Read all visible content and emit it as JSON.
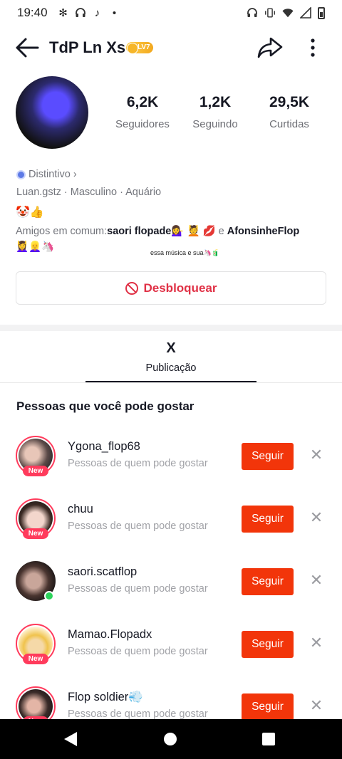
{
  "status_bar": {
    "time": "19:40",
    "left_icons": [
      "fan-icon",
      "headphones-icon",
      "tiktok-icon",
      "dot-icon"
    ],
    "right_icons": [
      "headset-icon",
      "vibrate-icon",
      "wifi-icon",
      "signal-icon",
      "battery-icon"
    ]
  },
  "header": {
    "title": "TdP Ln Xs",
    "level_badge": "LV7"
  },
  "profile": {
    "stats": [
      {
        "value": "6,2K",
        "label": "Seguidores"
      },
      {
        "value": "1,2K",
        "label": "Seguindo"
      },
      {
        "value": "29,5K",
        "label": "Curtidas"
      }
    ],
    "badge": "Distintivo",
    "info": "Luan.gstz  ·  Masculino  ·  Aquário",
    "bio_emoji": "🤡👍",
    "mutual_prefix": "Amigos em comum:",
    "mutual_name1": "saori flopade",
    "mutual_emoji1": "💁‍♀️ 💆 💋",
    "mutual_and": " e ",
    "mutual_name2": "AfonsinheFlop",
    "mutual_emoji2": "💆‍♀️👱‍♀️🦄",
    "caption": "essa música e sua🦄🧃"
  },
  "unblock_label": "Desbloquear",
  "tab": {
    "icon_text": "X",
    "label": "Publicação"
  },
  "suggestions": {
    "title": "Pessoas que você pode gostar",
    "follow_label": "Seguir",
    "items": [
      {
        "name": "Ygona_flop68",
        "sub": "Pessoas de quem pode gostar",
        "tag": "New"
      },
      {
        "name": "chuu",
        "sub": "Pessoas de quem pode gostar",
        "tag": "New"
      },
      {
        "name": "saori.scatflop",
        "sub": "Pessoas de quem pode gostar",
        "tag": ""
      },
      {
        "name": "Mamao.Flopadx",
        "sub": "Pessoas de quem pode gostar",
        "tag": "New"
      },
      {
        "name": "Flop soldier💨",
        "sub": "Pessoas de quem pode gostar",
        "tag": "New"
      }
    ]
  },
  "colors": {
    "follow_button": "#f2350a",
    "unblock_text": "#e03146",
    "new_tag": "#ff3b5c",
    "online_dot": "#2ed35c"
  }
}
